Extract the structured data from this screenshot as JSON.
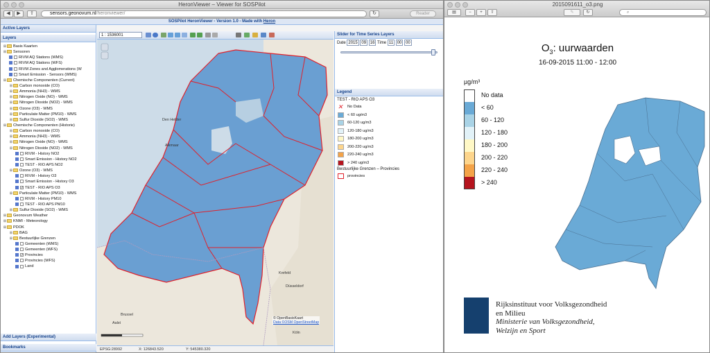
{
  "browser": {
    "window_title": "HeronViewer – Viewer for SOSPilot",
    "url_host": "sensors.geonovum.nl",
    "url_path": "/heronviewer/",
    "reader_label": "Reader"
  },
  "app": {
    "title_prefix": "SOSPilot HeronViewer - Version 1.0 - Made with ",
    "title_link": "Heron"
  },
  "left": {
    "active_layers": "Active Layers",
    "layers": "Layers",
    "add_layers": "Add Layers (Experimental)",
    "bookmarks": "Bookmarks",
    "tree": [
      {
        "label": "Basis Kaarten",
        "level": 0,
        "type": "folder"
      },
      {
        "label": "Sensoren",
        "level": 0,
        "type": "folder"
      },
      {
        "label": "RIVM AQ Stations (WMS)",
        "level": 1,
        "type": "layer"
      },
      {
        "label": "RIVM AQ Stations (WFS)",
        "level": 1,
        "type": "layer"
      },
      {
        "label": "RIVM Zones and Agglomerations (W",
        "level": 1,
        "type": "layer"
      },
      {
        "label": "Smart Emission - Sensors (WMS)",
        "level": 1,
        "type": "layer"
      },
      {
        "label": "Chemische Componenten (Current)",
        "level": 0,
        "type": "folder"
      },
      {
        "label": "Carbon monoxide (CO)",
        "level": 1,
        "type": "folder"
      },
      {
        "label": "Ammonia (NH3) - WMS",
        "level": 1,
        "type": "folder"
      },
      {
        "label": "Nitrogen Oxide (NO) - WMS",
        "level": 1,
        "type": "folder"
      },
      {
        "label": "Nitrogen Dioxide (NO2) - WMS",
        "level": 1,
        "type": "folder"
      },
      {
        "label": "Ozone (O3) - WMS",
        "level": 1,
        "type": "folder"
      },
      {
        "label": "Particulate Matter (PM10) - WMS",
        "level": 1,
        "type": "folder"
      },
      {
        "label": "Sulfur Dioxide (SO2) - WMS",
        "level": 1,
        "type": "folder"
      },
      {
        "label": "Chemische Componenten (Historie)",
        "level": 0,
        "type": "folder"
      },
      {
        "label": "Carbon monoxide (CO)",
        "level": 1,
        "type": "folder"
      },
      {
        "label": "Ammonia (NH3) - WMS",
        "level": 1,
        "type": "folder"
      },
      {
        "label": "Nitrogen Oxide (NO) - WMS",
        "level": 1,
        "type": "folder"
      },
      {
        "label": "Nitrogen Dioxide (NO2) - WMS",
        "level": 1,
        "type": "folder"
      },
      {
        "label": "RIVM - History NO2",
        "level": 2,
        "type": "layer"
      },
      {
        "label": "Smart Emission - History NO2",
        "level": 2,
        "type": "layer"
      },
      {
        "label": "TEST - RIO APS NO2",
        "level": 2,
        "type": "layer"
      },
      {
        "label": "Ozone (O3) - WMS",
        "level": 1,
        "type": "folder"
      },
      {
        "label": "RIVM - History O3",
        "level": 2,
        "type": "layer"
      },
      {
        "label": "Smart Emission - History O3",
        "level": 2,
        "type": "layer"
      },
      {
        "label": "TEST - RIO APS O3",
        "level": 2,
        "type": "layer",
        "checked": true
      },
      {
        "label": "Particulate Matter (PM10) - WMS",
        "level": 1,
        "type": "folder"
      },
      {
        "label": "RIVM - History PM10",
        "level": 2,
        "type": "layer"
      },
      {
        "label": "TEST - RIO APS PM10",
        "level": 2,
        "type": "layer"
      },
      {
        "label": "Sulfur Dioxide (SO2) - WMS",
        "level": 1,
        "type": "folder"
      },
      {
        "label": "Geonovum Weather",
        "level": 0,
        "type": "folder"
      },
      {
        "label": "KNMI - Meteorology",
        "level": 0,
        "type": "folder"
      },
      {
        "label": "PDOK",
        "level": 0,
        "type": "folder"
      },
      {
        "label": "BAG",
        "level": 1,
        "type": "folder"
      },
      {
        "label": "Bestuurlijke Grenzen",
        "level": 1,
        "type": "folder"
      },
      {
        "label": "Gemeenten (WMS)",
        "level": 2,
        "type": "layer"
      },
      {
        "label": "Gemeenten (WFS)",
        "level": 2,
        "type": "layer"
      },
      {
        "label": "Provincies",
        "level": 2,
        "type": "layer",
        "checked": true
      },
      {
        "label": "Provincies (WFS)",
        "level": 2,
        "type": "layer"
      },
      {
        "label": "Land",
        "level": 2,
        "type": "layer"
      }
    ]
  },
  "map": {
    "scale": "1 : 1536001",
    "cities": [
      "Den Helder",
      "Alkmaar",
      "Krefeld",
      "Düsseldorf",
      "Köln",
      "Brussel",
      "Aalst"
    ],
    "copyright_line1": "© OpenBasisKaart",
    "copyright_line2": "Data ©OSM OpenStreetMap",
    "status_epsg": "EPSG:28992",
    "status_x": "X: 126843.520",
    "status_y": "Y: 545380.320"
  },
  "right_panel": {
    "slider_title": "Slider for Time Series Layers",
    "date_label": "Date",
    "year": "2015",
    "month": "09",
    "day": "16",
    "time_label": "Time",
    "hour": "11",
    "minute": "00",
    "second": "00",
    "legend_title": "Legend",
    "layer_name": "TEST - RIO APS O3",
    "legend_items": [
      {
        "label": "No Data",
        "color": "#ffffff"
      },
      {
        "label": "< 60 ug/m3",
        "color": "#6aaad6"
      },
      {
        "label": "60-120 ug/m3",
        "color": "#a9d3e6"
      },
      {
        "label": "120-180 ug/m3",
        "color": "#e2f2f8"
      },
      {
        "label": "180-200 ug/m3",
        "color": "#fff8c6"
      },
      {
        "label": "200-220 ug/m3",
        "color": "#fdd58c"
      },
      {
        "label": "220-240 ug/m3",
        "color": "#f4a348"
      },
      {
        "label": "> 240 ug/m3",
        "color": "#b5141e"
      }
    ],
    "boundaries_title": "Bestuurlijke Grenzen – Provincies",
    "boundaries_item": "provincies"
  },
  "preview": {
    "window_title": "2015091611_o3.png",
    "title_main": "O",
    "title_sub": "3",
    "title_rest": ": uurwaarden",
    "subtitle": "16-09-2015 11:00 - 12:00",
    "unit": "µg/m³",
    "legend": [
      {
        "label": "No data",
        "color": "#ffffff"
      },
      {
        "label": "< 60",
        "color": "#6aaad6"
      },
      {
        "label": "60 - 120",
        "color": "#a9d3e6"
      },
      {
        "label": "120 - 180",
        "color": "#e2f2f8"
      },
      {
        "label": "180 - 200",
        "color": "#fff8c6"
      },
      {
        "label": "200 - 220",
        "color": "#fdd58c"
      },
      {
        "label": "220 - 240",
        "color": "#f4a348"
      },
      {
        "label": "> 240",
        "color": "#b5141e"
      }
    ],
    "org_line1": "Rijksinstituut voor Volksgezondheid",
    "org_line2": "en Milieu",
    "org_line3": "Ministerie van Volksgezondheid,",
    "org_line4": "Welzijn en Sport"
  }
}
